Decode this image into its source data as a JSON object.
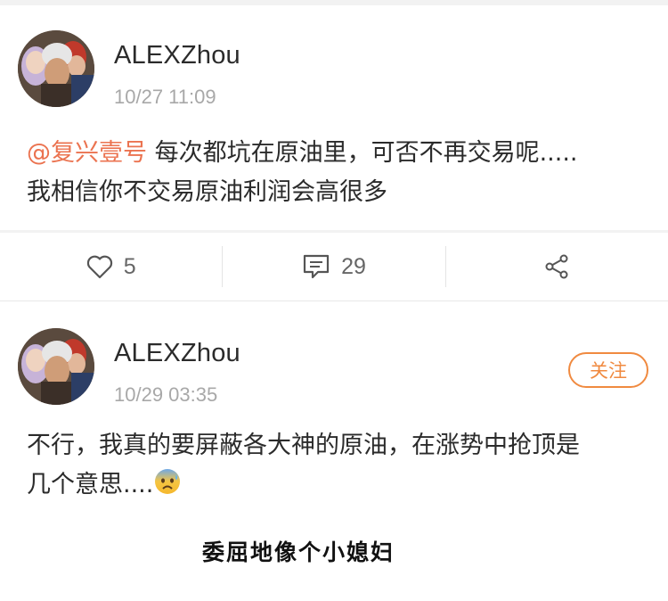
{
  "post1": {
    "username": "ALEXZhou",
    "timestamp": "10/27 11:09",
    "mention": "@复兴壹号",
    "text_line1": " 每次都坑在原油里，可否不再交易呢.....",
    "text_line2": "我相信你不交易原油利润会高很多"
  },
  "actions": {
    "likes": "5",
    "comments": "29"
  },
  "post2": {
    "username": "ALEXZhou",
    "timestamp": "10/29 03:35",
    "follow_label": "关注",
    "text_line1": "不行，我真的要屏蔽各大神的原油，在涨势中抢顶是",
    "text_line2": "几个意思....",
    "emoji": "anxious-sweat-face-icon"
  },
  "caption": "委屈地像个小媳妇",
  "colors": {
    "mention": "#eb7350",
    "follow": "#f08a40",
    "timestamp": "#a8a8a8"
  }
}
